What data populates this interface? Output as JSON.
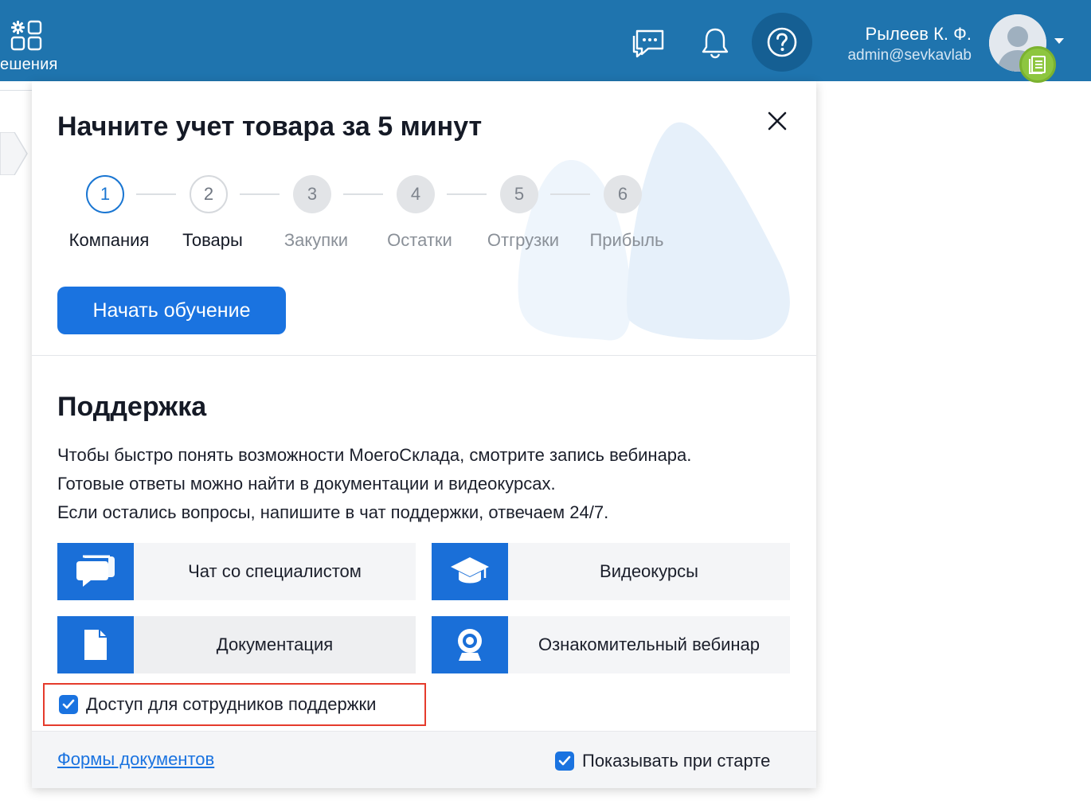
{
  "header": {
    "apps_label": "ешения",
    "user_name": "Рылеев К. Ф.",
    "user_email": "admin@sevkavlab",
    "icons": [
      "apps-icon",
      "chat-icon",
      "bell-icon",
      "help-icon",
      "avatar",
      "documents-badge-icon",
      "chevron-down-icon"
    ]
  },
  "onboarding": {
    "title": "Начните учет товара за 5 минут",
    "steps": [
      {
        "number": "1",
        "label": "Компания",
        "state": "active"
      },
      {
        "number": "2",
        "label": "Товары",
        "state": "done"
      },
      {
        "number": "3",
        "label": "Закупки",
        "state": "todo"
      },
      {
        "number": "4",
        "label": "Остатки",
        "state": "todo"
      },
      {
        "number": "5",
        "label": "Отгрузки",
        "state": "todo"
      },
      {
        "number": "6",
        "label": "Прибыль",
        "state": "todo"
      }
    ],
    "start_button": "Начать обучение"
  },
  "support": {
    "title": "Поддержка",
    "lines": [
      "Чтобы быстро понять возможности МоегоСклада, смотрите запись вебинара.",
      "Готовые ответы можно найти в документации и видеокурсах.",
      "Если остались вопросы, напишите в чат поддержки, отвечаем 24/7."
    ],
    "tiles": [
      {
        "label": "Чат со специалистом",
        "icon": "chat-bubbles-icon"
      },
      {
        "label": "Видеокурсы",
        "icon": "graduation-cap-icon"
      },
      {
        "label": "Документация",
        "icon": "document-icon"
      },
      {
        "label": "Ознакомительный вебинар",
        "icon": "webcam-icon"
      }
    ],
    "access_checkbox": {
      "label": "Доступ для сотрудников поддержки",
      "checked": true
    }
  },
  "footer": {
    "forms_link": "Формы документов",
    "show_on_start": {
      "label": "Показывать при старте",
      "checked": true
    }
  },
  "colors": {
    "topbar": "#1f74ae",
    "accent": "#1a73e0",
    "highlight_border": "#e53b2c",
    "badge": "#8dc63f"
  }
}
